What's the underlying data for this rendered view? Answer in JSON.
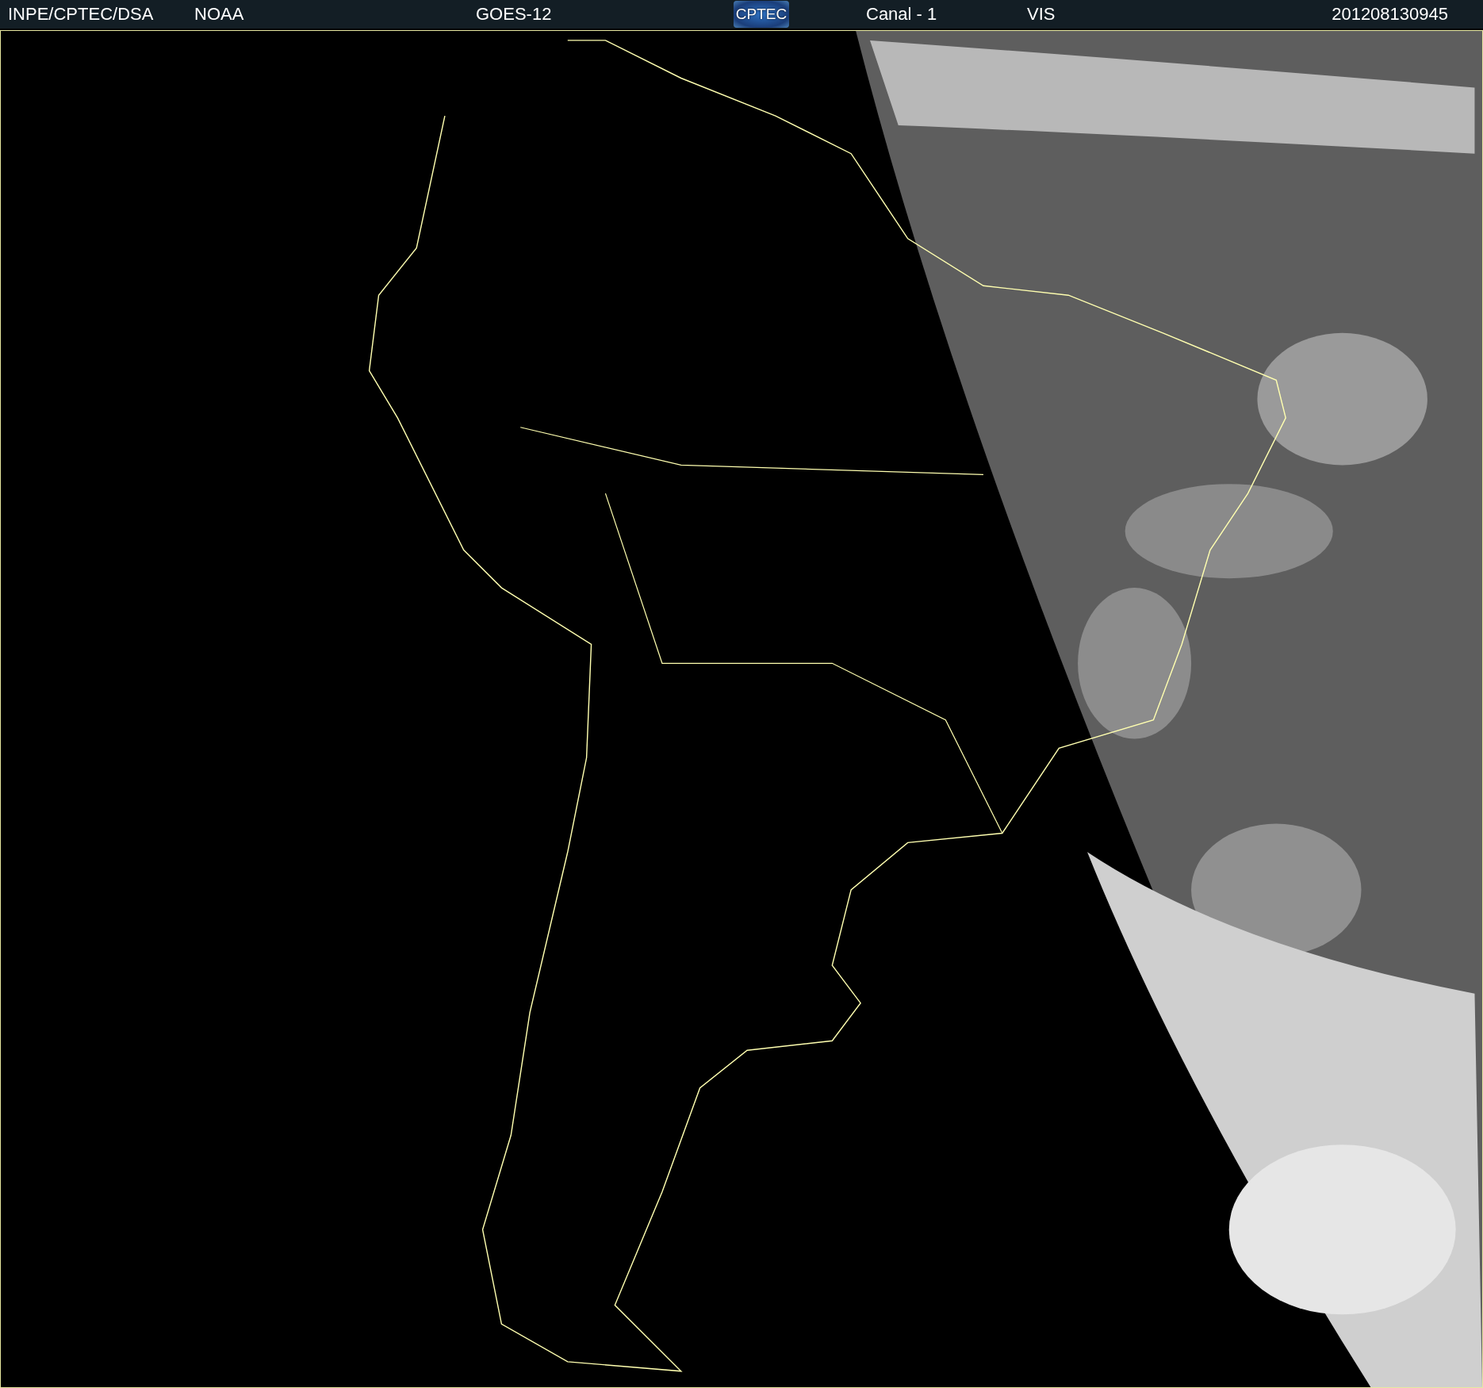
{
  "header": {
    "source": "INPE/CPTEC/DSA",
    "agency": "NOAA",
    "satellite": "GOES-12",
    "logo_text": "CPTEC",
    "channel": "Canal - 1",
    "band": "VIS",
    "timestamp": "201208130945"
  }
}
